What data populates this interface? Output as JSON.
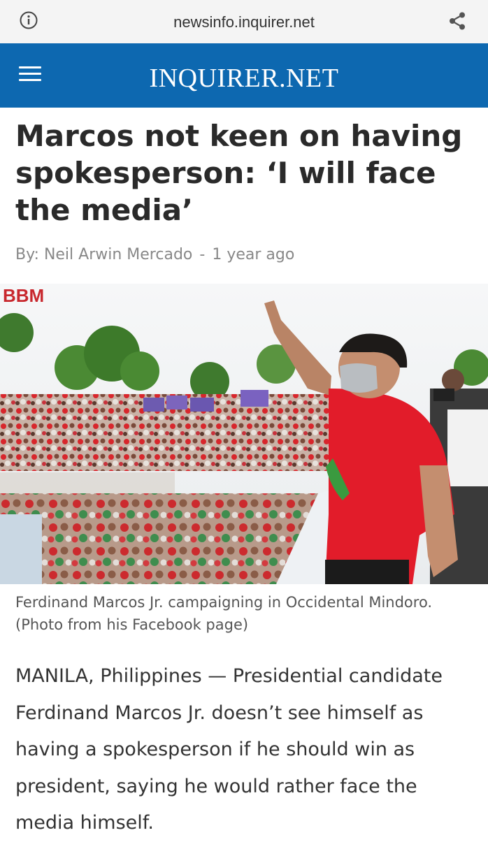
{
  "browser": {
    "url": "newsinfo.inquirer.net"
  },
  "site": {
    "logo_text": "INQUIRER.NET",
    "brand_color": "#0d68b0"
  },
  "article": {
    "headline": "Marcos not keen on having spokesperson: ‘I will face the media’",
    "byline_prefix": "By:",
    "author": "Neil Arwin Mercado",
    "separator": "-",
    "time_ago": "1 year ago",
    "photo": {
      "banner_text": "BBM"
    },
    "caption": "Ferdinand Marcos Jr. campaigning in Occidental Mindoro. (Photo from his Facebook page)",
    "body": "MANILA, Philippines — Presidential candidate Ferdinand Marcos Jr. doesn’t see himself as having a spokesperson if he should win as president, saying he would rather face the media himself."
  },
  "icons": {
    "info": "info-icon",
    "share": "share-icon",
    "menu": "hamburger-menu-icon"
  }
}
